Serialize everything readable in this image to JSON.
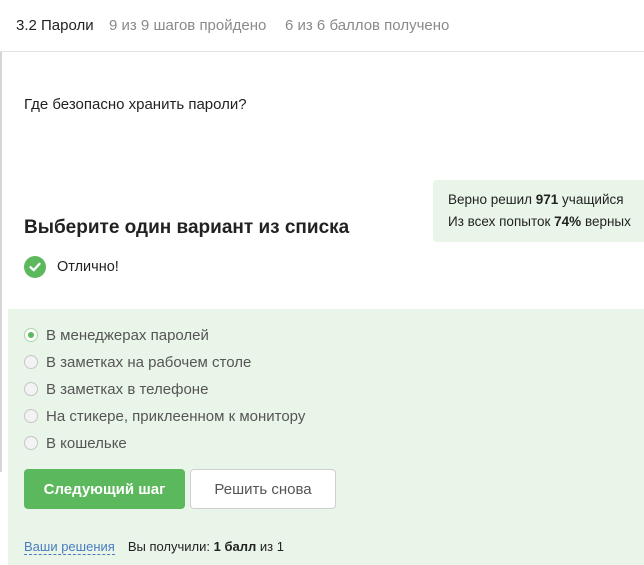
{
  "header": {
    "lesson": "3.2 Пароли",
    "steps": "9 из 9 шагов пройдено",
    "points": "6 из 6 баллов  получено"
  },
  "question": "Где безопасно хранить пароли?",
  "stats": {
    "line1_prefix": "Верно решил ",
    "solvers": "971",
    "line1_suffix": " учащийся",
    "line2_prefix": "Из всех попыток ",
    "percent": "74%",
    "line2_suffix": " верных"
  },
  "task": {
    "title": "Выберите один вариант из списка",
    "status": "Отлично!"
  },
  "options": [
    {
      "label": "В менеджерах паролей",
      "selected": true
    },
    {
      "label": "В заметках на рабочем столе",
      "selected": false
    },
    {
      "label": "В заметках в телефоне",
      "selected": false
    },
    {
      "label": "На стикере, приклеенном к монитору",
      "selected": false
    },
    {
      "label": "В кошельке",
      "selected": false
    }
  ],
  "buttons": {
    "next": "Следующий шаг",
    "retry": "Решить снова"
  },
  "footer": {
    "solutions_link": "Ваши решения",
    "received_prefix": "Вы получили: ",
    "received_value": "1 балл",
    "received_suffix": " из 1"
  },
  "colors": {
    "accent_green": "#5cb85c",
    "panel_green": "#e9f5e9",
    "link_blue": "#4a7bbf"
  }
}
